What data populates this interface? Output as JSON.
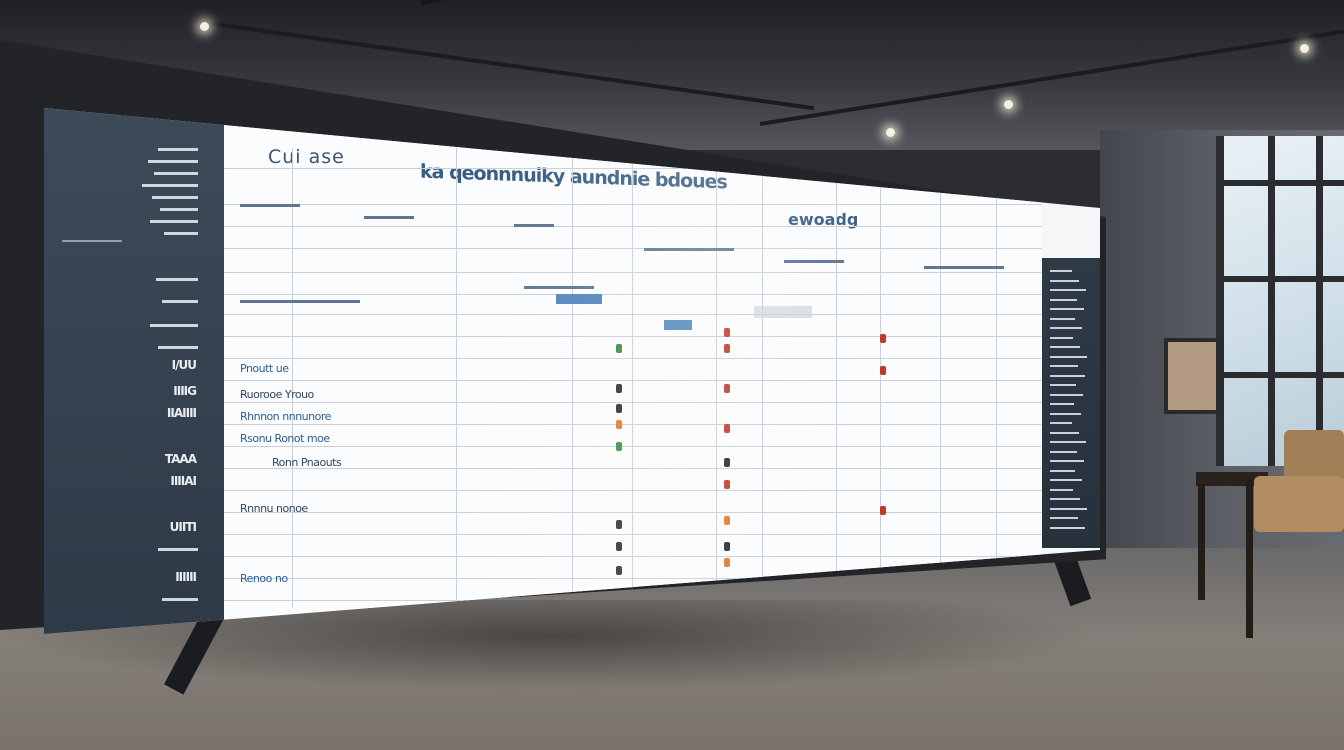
{
  "screen": {
    "app_title": "Cui ase",
    "left_nav": {
      "items": [
        "I/UU",
        "IIIIG",
        "IIAIIII",
        "TAAA",
        "IIIIAI",
        "UIITI",
        "IIIIII"
      ]
    },
    "sheet": {
      "header_caption": "ka qeonnnuiky aundnie bdoues",
      "header_caption_2": "ewoadg",
      "row_labels": [
        "Pnoutt ue",
        "Ruorooe Yrouo",
        "Rhnnon nnnunore",
        "Rsonu Ronot moe",
        "Ronn Pnaouts",
        "Rnnnu nonoe",
        "Renoo no"
      ]
    },
    "marker_colors": {
      "red": "#c0392b",
      "orange": "#e0782a",
      "green": "#3a8a3a",
      "dark": "#2a2a2a"
    }
  }
}
